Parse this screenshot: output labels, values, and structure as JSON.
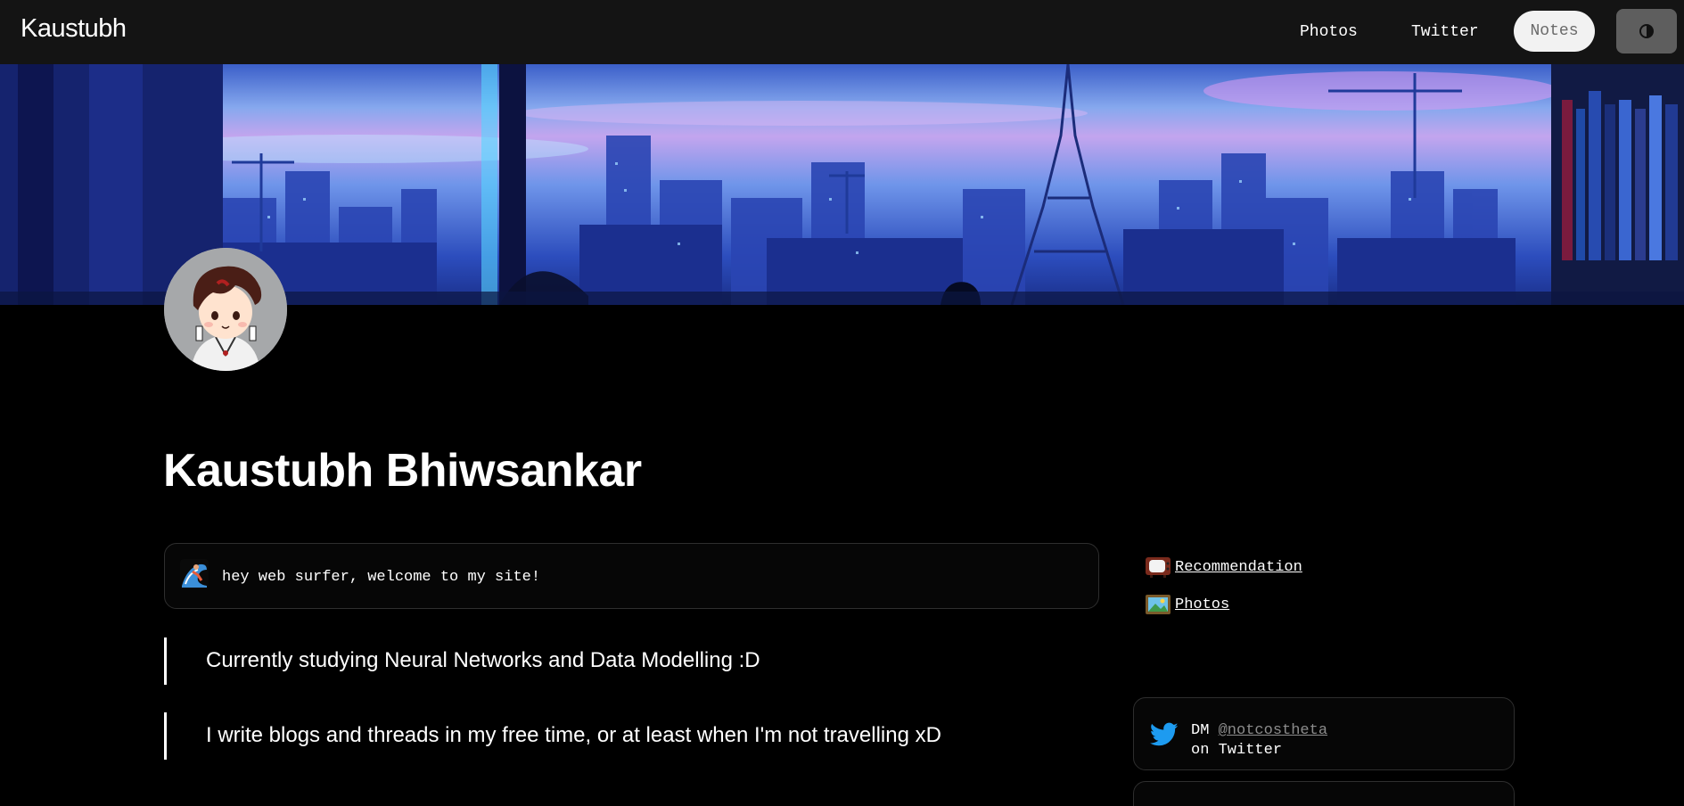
{
  "header": {
    "brand": "Kaustubh",
    "nav": {
      "photos": "Photos",
      "twitter": "Twitter",
      "notes": "Notes"
    },
    "theme_toggle_icon": "theme-toggle-icon"
  },
  "profile": {
    "name": "Kaustubh Bhiwsankar",
    "banner_icon": "city-skyline-banner",
    "avatar_icon": "anime-avatar"
  },
  "welcome": {
    "emoji": "wave-surfer-emoji",
    "text": "hey web surfer, welcome to my site!"
  },
  "quotes": [
    "Currently studying Neural Networks and Data Modelling :D",
    "I write blogs and threads in my free time, or at least when I'm not travelling xD"
  ],
  "sidebar": {
    "links": [
      {
        "label": "Recommendation",
        "icon": "tv-icon"
      },
      {
        "label": "Photos",
        "icon": "photo-frame-icon"
      }
    ],
    "twitter_card": {
      "prefix": "DM",
      "handle": "@notcostheta",
      "suffix": "on Twitter",
      "icon": "twitter-bird-icon"
    }
  },
  "colors": {
    "nav_bg": "#141414",
    "page_bg": "#000000",
    "twitter_blue": "#1d9bf0",
    "notes_pill": "#f2f2f2"
  }
}
